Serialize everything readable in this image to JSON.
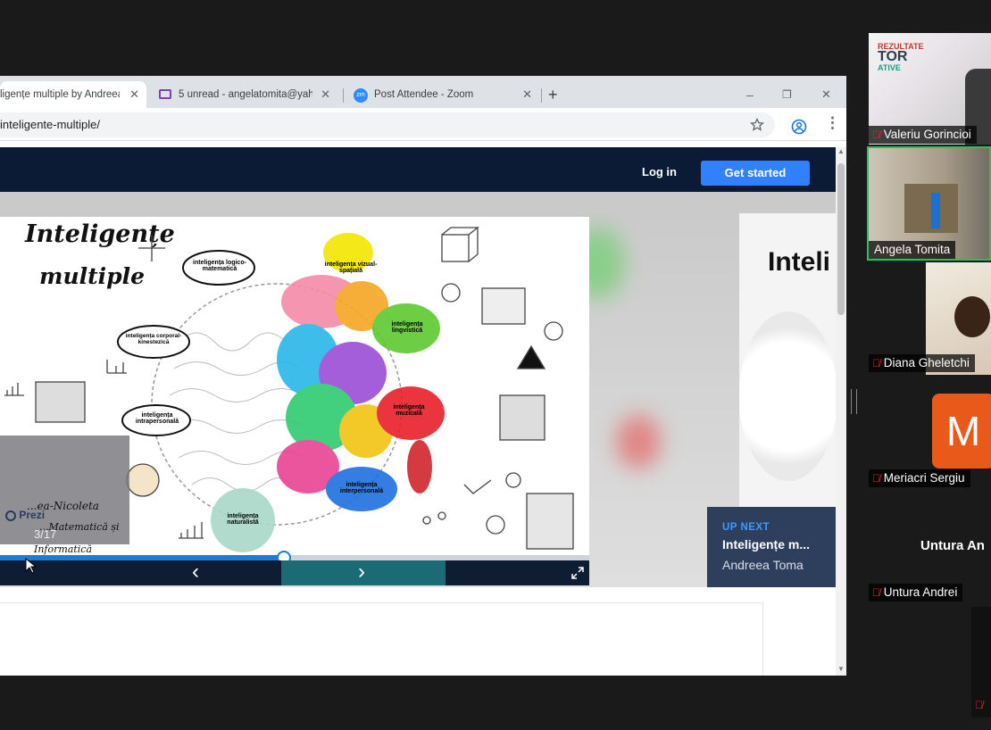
{
  "browser": {
    "tabs": [
      {
        "title": "ligențe multiple by Andreea"
      },
      {
        "title": "5 unread - angelatomita@yaho"
      },
      {
        "title": "Post Attendee - Zoom"
      }
    ],
    "new_tab": "+",
    "url": "inteligente-multiple/",
    "window_controls": {
      "minimize": "–",
      "restore": "❐",
      "close": "✕"
    }
  },
  "prezi": {
    "login_label": "Log in",
    "get_started_label": "Get started",
    "slide": {
      "title_line1": "Inteligențe",
      "title_line2": "multiple",
      "nodes": [
        "inteligența logico-matematică",
        "inteligența vizual-spațială",
        "inteligența corporal-kinestezică",
        "inteligența lingvistică",
        "inteligența intrapersonală",
        "inteligența muzicală",
        "inteligența naturalistă",
        "inteligența interpersonală"
      ],
      "author_lines": [
        "...ea-Nicoleta",
        "...Matematică și",
        "Informatică"
      ],
      "logo": "Prezi",
      "page_counter": "3/17",
      "progress": 0.33
    },
    "side_card_title": "Inteli",
    "up_next": {
      "label": "UP NEXT",
      "title": "Inteligențe m...",
      "author": "Andreea Toma"
    },
    "nav": {
      "prev": "‹",
      "next": "›"
    }
  },
  "zoom": {
    "participants": [
      {
        "name": "Valeriu Gorincioi",
        "muted": true
      },
      {
        "name": "Angela Tomita",
        "muted": false
      },
      {
        "name": "Diana Gheletchi",
        "muted": true
      },
      {
        "name": "Meriacri Sergiu",
        "muted": true,
        "initial": "M"
      },
      {
        "name": "Untura Andrei",
        "muted": true,
        "display_name": "Untura An"
      }
    ]
  },
  "colors": {
    "prezi_header": "#0b1b35",
    "get_started": "#3181ff",
    "active_speaker_border": "#22c55e",
    "avatar_orange": "#e8591a",
    "mute_red": "#e02828",
    "progress_blue": "#1a7ddb"
  }
}
